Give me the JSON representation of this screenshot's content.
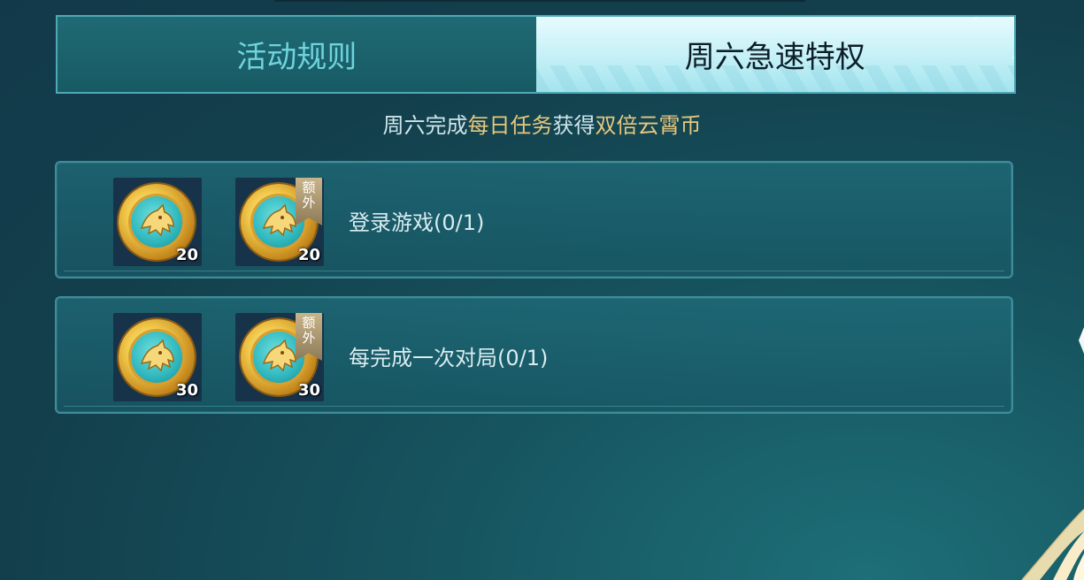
{
  "tabs": {
    "rules_label": "活动规则",
    "active_label": "周六急速特权"
  },
  "subtitle": {
    "prefix": "周六完成",
    "highlight1": "每日任务",
    "middle": "获得",
    "highlight2": "双倍云霄币"
  },
  "tasks": [
    {
      "label": "登录游戏",
      "progress": "(0/1)",
      "rewards": [
        {
          "qty": "20",
          "badge": ""
        },
        {
          "qty": "20",
          "badge_top": "额",
          "badge_bottom": "外"
        }
      ]
    },
    {
      "label": "每完成一次对局",
      "progress": "(0/1)",
      "rewards": [
        {
          "qty": "30",
          "badge": ""
        },
        {
          "qty": "30",
          "badge_top": "额",
          "badge_bottom": "外"
        }
      ]
    }
  ],
  "colors": {
    "highlight": "#e8c77c",
    "tab_inactive_text": "#6fd3dc",
    "tab_active_text": "#0d1e28",
    "row_border": "#3d8e9a"
  },
  "icons": [
    "wolf-coin-icon"
  ]
}
